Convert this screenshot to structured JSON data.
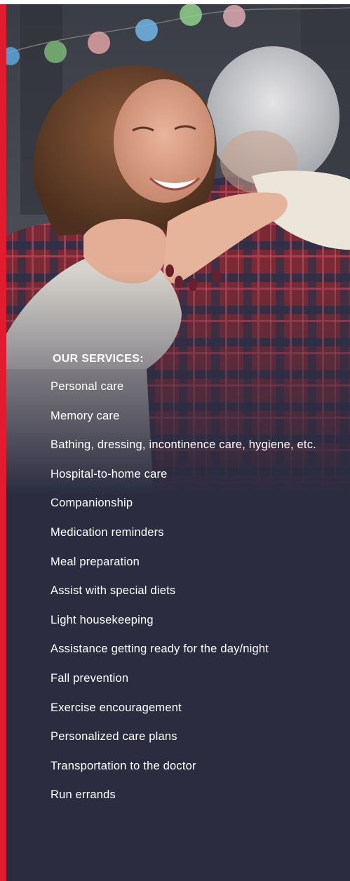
{
  "services": {
    "title": "OUR SERVICES:",
    "items": [
      "Personal care",
      "Memory care",
      "Bathing, dressing, incontinence care, hygiene, etc.",
      "Hospital-to-home care",
      "Companionship",
      "Medication reminders",
      "Meal preparation",
      "Assist with special diets",
      "Light housekeeping",
      "Assistance getting ready for the day/night",
      "Fall prevention",
      "Exercise encouragement",
      "Personalized care plans",
      "Transportation to the doctor",
      "Run errands"
    ]
  },
  "photo": {
    "subject": "hero-photo-embracing-couple"
  },
  "colors": {
    "accent": "#e31b2f",
    "panel": "#2b2c40",
    "text": "#ffffff"
  }
}
